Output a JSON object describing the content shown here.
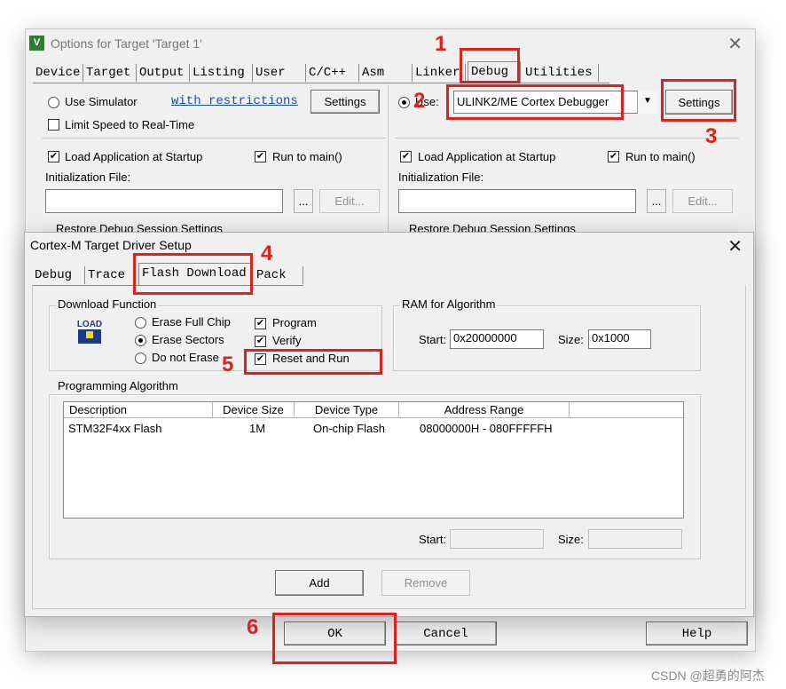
{
  "outer_window": {
    "title": "Options for Target 'Target 1'",
    "tabs": [
      "Device",
      "Target",
      "Output",
      "Listing",
      "User",
      "C/C++",
      "Asm",
      "Linker",
      "Debug",
      "Utilities"
    ],
    "active_tab": "Debug",
    "left": {
      "use_simulator_label": "Use Simulator",
      "with_restrictions_link": "with restrictions",
      "settings_label": "Settings",
      "limit_speed_label": "Limit Speed to Real-Time",
      "load_app_label": "Load Application at Startup",
      "run_to_main_label": "Run to main()",
      "init_file_label": "Initialization File:",
      "browse_label": "...",
      "edit_label": "Edit...",
      "restore_label": "Restore Debug Session Settings"
    },
    "right": {
      "use_label": "Use:",
      "debugger_value": "ULINK2/ME Cortex Debugger",
      "settings_label": "Settings",
      "load_app_label": "Load Application at Startup",
      "run_to_main_label": "Run to main()",
      "init_file_label": "Initialization File:",
      "browse_label": "...",
      "edit_label": "Edit...",
      "restore_label": "Restore Debug Session Settings"
    },
    "ok_label": "OK",
    "cancel_label": "Cancel",
    "help_label": "Help"
  },
  "inner_window": {
    "title": "Cortex-M Target Driver Setup",
    "tabs": [
      "Debug",
      "Trace",
      "Flash Download",
      "Pack"
    ],
    "active_tab": "Flash Download",
    "download_function": {
      "group_label": "Download Function",
      "load_icon_text": "LOAD",
      "erase_full_chip": "Erase Full Chip",
      "erase_sectors": "Erase Sectors",
      "do_not_erase": "Do not Erase",
      "selected_erase": "Erase Sectors",
      "program": "Program",
      "verify": "Verify",
      "reset_and_run": "Reset and Run"
    },
    "ram": {
      "group_label": "RAM for Algorithm",
      "start_label": "Start:",
      "start_value": "0x20000000",
      "size_label": "Size:",
      "size_value": "0x1000"
    },
    "programming_algorithm": {
      "group_label": "Programming Algorithm",
      "columns": [
        "Description",
        "Device Size",
        "Device Type",
        "Address Range"
      ],
      "rows": [
        {
          "description": "STM32F4xx Flash",
          "device_size": "1M",
          "device_type": "On-chip Flash",
          "address_range": "08000000H - 080FFFFFH"
        }
      ],
      "start_label": "Start:",
      "size_label": "Size:"
    },
    "add_label": "Add",
    "remove_label": "Remove"
  },
  "annotations": {
    "n1": "1",
    "n2": "2",
    "n3": "3",
    "n4": "4",
    "n5": "5",
    "n6": "6"
  },
  "watermark": "CSDN @超勇的阿杰",
  "colors": {
    "annotation_red": "#e0201e",
    "link_blue": "#1a4fb0"
  }
}
